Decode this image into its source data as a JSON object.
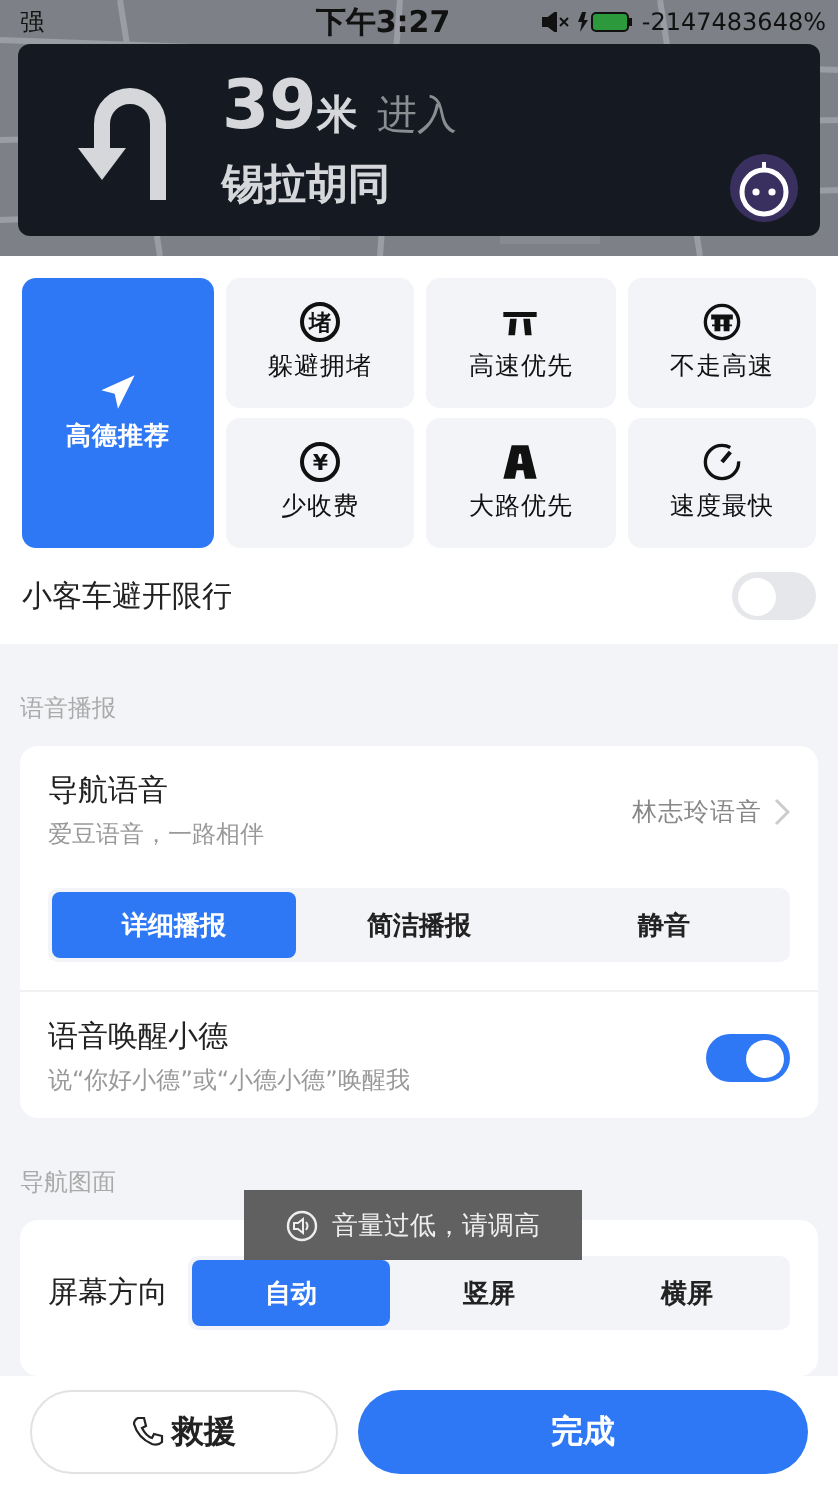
{
  "status_bar": {
    "signal": "强",
    "time": "下午3:27",
    "battery": "-2147483648%"
  },
  "navigation": {
    "distance": "39",
    "unit": "米",
    "action": "进入",
    "road": "锡拉胡同"
  },
  "route_options": [
    {
      "kind": "recommend",
      "label": "高德推荐",
      "selected": true
    },
    {
      "kind": "avoid_jam",
      "label": "躲避拥堵",
      "icon_glyph": "堵",
      "selected": false
    },
    {
      "kind": "highway",
      "label": "高速优先",
      "selected": false
    },
    {
      "kind": "no_highway",
      "label": "不走高速",
      "selected": false
    },
    {
      "kind": "less_toll",
      "label": "少收费",
      "icon_glyph": "¥",
      "selected": false
    },
    {
      "kind": "main_road",
      "label": "大路优先",
      "selected": false
    },
    {
      "kind": "fastest",
      "label": "速度最快",
      "selected": false
    }
  ],
  "restriction": {
    "label": "小客车避开限行",
    "on": false
  },
  "voice_section": {
    "title": "语音播报",
    "nav_voice": {
      "title": "导航语音",
      "subtitle": "爱豆语音，一路相伴",
      "value": "林志玲语音"
    },
    "modes": [
      {
        "label": "详细播报",
        "selected": true
      },
      {
        "label": "简洁播报",
        "selected": false
      },
      {
        "label": "静音",
        "selected": false
      }
    ],
    "wake": {
      "title": "语音唤醒小德",
      "subtitle": "说“你好小德”或“小德小德”唤醒我",
      "on": true
    }
  },
  "display_section": {
    "title": "导航图面",
    "orientation": {
      "label": "屏幕方向",
      "options": [
        {
          "label": "自动",
          "selected": true
        },
        {
          "label": "竖屏",
          "selected": false
        },
        {
          "label": "横屏",
          "selected": false
        }
      ]
    }
  },
  "toast": {
    "text": "音量过低，请调高"
  },
  "buttons": {
    "rescue": "救援",
    "done": "完成"
  }
}
